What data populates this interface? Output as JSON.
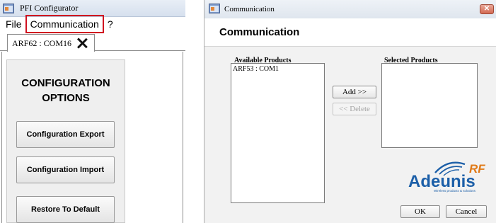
{
  "left_window": {
    "title": "PFI Configurator",
    "menu": [
      {
        "label": "File"
      },
      {
        "label": "Communication",
        "highlighted": true
      },
      {
        "label": "?"
      }
    ],
    "tab": {
      "label": "ARF62 : COM16",
      "close_icon": "close-icon"
    },
    "options": {
      "title_line1": "CONFIGURATION",
      "title_line2": "OPTIONS",
      "buttons": [
        "Configuration Export",
        "Configuration Import",
        "Restore To Default"
      ]
    },
    "colors": {
      "highlight": "#d01020",
      "options_bg": "#efefef"
    }
  },
  "dialog": {
    "title": "Communication",
    "heading": "Communication",
    "available_label": "Available Products",
    "available_items": [
      "ARF53 : COM1"
    ],
    "selected_label": "Selected Products",
    "selected_items": [],
    "add_label": "Add >>",
    "delete_label": "<< Delete",
    "ok_label": "OK",
    "cancel_label": "Cancel",
    "logo": {
      "name": "Adeunis",
      "suffix": "RF",
      "tagline": "Wireless products & solutions"
    },
    "colors": {
      "logo_blue": "#1c5fa8",
      "logo_orange": "#e07a18",
      "close_red": "#d46a52"
    }
  }
}
